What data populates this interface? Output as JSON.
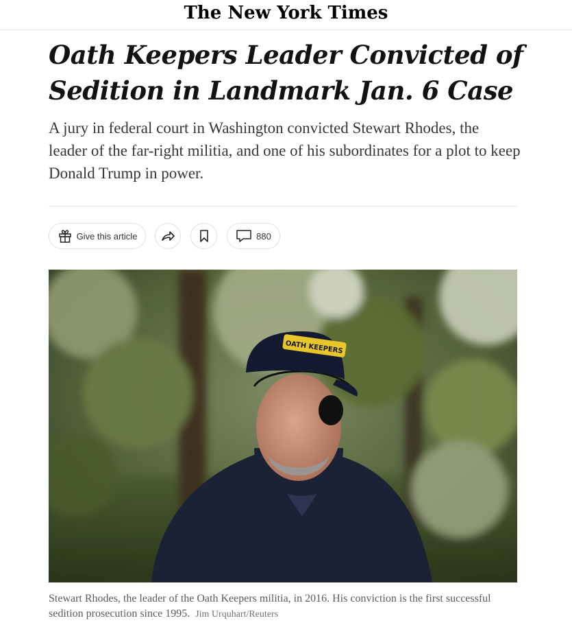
{
  "masthead": {
    "logo_text": "The New York Times"
  },
  "article": {
    "headline": "Oath Keepers Leader Convicted of Sedition in Landmark Jan. 6 Case",
    "summary": "A jury in federal court in Washington convicted Stewart Rhodes, the leader of the far-right militia, and one of his subordinates for a plot to keep Donald Trump in power."
  },
  "toolbar": {
    "gift_label": "Give this article",
    "comment_count": "880",
    "icons": {
      "gift": "gift-icon",
      "share": "share-arrow-icon",
      "save": "bookmark-icon",
      "comments": "comment-bubble-icon"
    }
  },
  "photo": {
    "cap_text": "OATH KEEPERS",
    "caption": "Stewart Rhodes, the leader of the Oath Keepers militia, in 2016. His conviction is the first successful sedition prosecution since 1995.",
    "credit": "Jim Urquhart/Reuters"
  }
}
